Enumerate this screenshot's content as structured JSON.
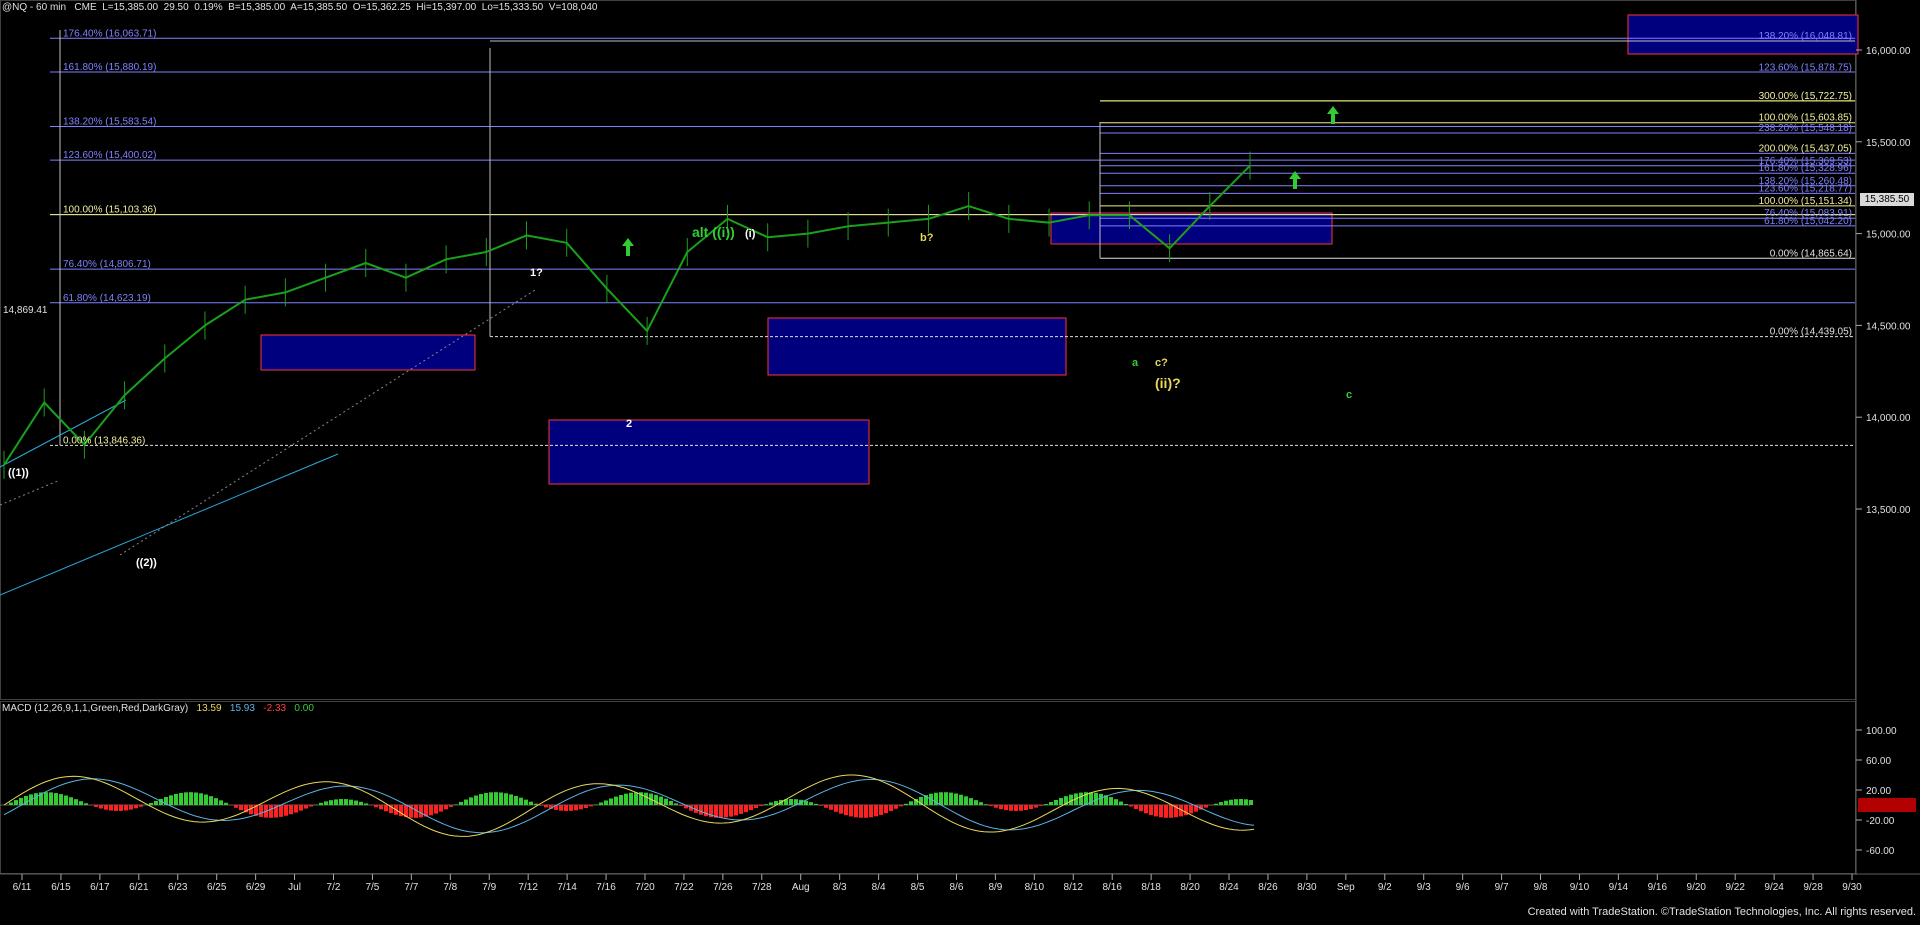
{
  "header": {
    "symbol": "@NQ - 60 min",
    "exchange": "CME",
    "last": "L=15,385.00",
    "change": "29.50",
    "change_pct": "0.19%",
    "bid": "B=15,385.00",
    "ask": "A=15,385.50",
    "open": "O=15,362.25",
    "high": "Hi=15,397.00",
    "low": "Lo=15,333.50",
    "volume": "V=108,040"
  },
  "price_axis": {
    "ticks": [
      {
        "value": 16000,
        "label": "16,000.00"
      },
      {
        "value": 15500,
        "label": "15,500.00"
      },
      {
        "value": 15000,
        "label": "15,000.00"
      },
      {
        "value": 14500,
        "label": "14,500.00"
      },
      {
        "value": 14000,
        "label": "14,000.00"
      },
      {
        "value": 13500,
        "label": "13,500.00"
      }
    ],
    "last_price_marker": "15,385.50",
    "left_marker": "14,869.41"
  },
  "macd": {
    "title": "MACD (12,26,9,1,1,Green,Red,DarkGray)",
    "values": [
      "13.59",
      "15.93",
      "-2.33",
      "0.00"
    ],
    "value_colors": [
      "#e8d85a",
      "#5ab4e8",
      "#ff4040",
      "#33cc33"
    ],
    "ticks": [
      "100.00",
      "60.00",
      "20.00",
      "-20.00",
      "-60.00"
    ]
  },
  "time_axis": [
    "6/11",
    "6/15",
    "6/17",
    "6/21",
    "6/23",
    "6/25",
    "6/29",
    "Jul",
    "7/2",
    "7/5",
    "7/7",
    "7/8",
    "7/9",
    "7/12",
    "7/14",
    "7/16",
    "7/20",
    "7/22",
    "7/26",
    "7/28",
    "Aug",
    "8/3",
    "8/4",
    "8/5",
    "8/6",
    "8/9",
    "8/10",
    "8/12",
    "8/16",
    "8/18",
    "8/20",
    "8/24",
    "8/26",
    "8/30",
    "Sep",
    "9/2",
    "9/3",
    "9/6",
    "9/7",
    "9/8",
    "9/10",
    "9/14",
    "9/16",
    "9/20",
    "9/22",
    "9/24",
    "9/28",
    "9/30"
  ],
  "fib_labels": [
    {
      "text": "176.40% (16,063.71)",
      "price": 16063.71,
      "side": "left"
    },
    {
      "text": "161.80% (15,880.19)",
      "price": 15880.19,
      "side": "left"
    },
    {
      "text": "138.20% (15,583.54)",
      "price": 15583.54,
      "side": "left"
    },
    {
      "text": "123.60% (15,400.02)",
      "price": 15400.02,
      "side": "left"
    },
    {
      "text": "100.00% (15,103.36)",
      "price": 15103.36,
      "side": "left"
    },
    {
      "text": "76.40% (14,806.71)",
      "price": 14806.71,
      "side": "left"
    },
    {
      "text": "61.80% (14,623.19)",
      "price": 14623.19,
      "side": "left"
    },
    {
      "text": "0.00% (13,846.36)",
      "price": 13846.36,
      "side": "left"
    },
    {
      "text": "138.20% (16,048.81)",
      "price": 16048.81,
      "side": "right"
    },
    {
      "text": "123.60% (15,878.75)",
      "price": 15878.75,
      "side": "right"
    },
    {
      "text": "300.00% (15,722.75)",
      "price": 15722.75,
      "side": "right"
    },
    {
      "text": "100.00% (15,603.85)",
      "price": 15603.85,
      "side": "right"
    },
    {
      "text": "238.20% (15,548.18)",
      "price": 15548.18,
      "side": "right"
    },
    {
      "text": "200.00% (15,437.05)",
      "price": 15437.05,
      "side": "right"
    },
    {
      "text": "176.40% (15,369.53)",
      "price": 15369.53,
      "side": "right"
    },
    {
      "text": "161.80% (15,328.96)",
      "price": 15328.96,
      "side": "right"
    },
    {
      "text": "138.20% (15,260.48)",
      "price": 15260.48,
      "side": "right"
    },
    {
      "text": "123.60% (15,218.77)",
      "price": 15218.77,
      "side": "right"
    },
    {
      "text": "100.00% (15,151.34)",
      "price": 15151.34,
      "side": "right"
    },
    {
      "text": "76.40% (15,083.91)",
      "price": 15083.91,
      "side": "right"
    },
    {
      "text": "61.80% (15,042.20)",
      "price": 15042.2,
      "side": "right"
    },
    {
      "text": "0.00% (14,865.64)",
      "price": 14865.64,
      "side": "right"
    },
    {
      "text": "0.00% (14,439.05)",
      "price": 14439.05,
      "side": "right"
    }
  ],
  "wave_labels": [
    {
      "text": "((1))",
      "color": "#ffffff"
    },
    {
      "text": "((2))",
      "color": "#ffffff"
    },
    {
      "text": "1?",
      "color": "#ffffff"
    },
    {
      "text": "2",
      "color": "#ffffff"
    },
    {
      "text": "alt ((i))",
      "color": "#33cc33"
    },
    {
      "text": "(i)",
      "color": "#ffffff"
    },
    {
      "text": "b?",
      "color": "#e8d85a"
    },
    {
      "text": "a",
      "color": "#33cc33"
    },
    {
      "text": "c?",
      "color": "#e8d85a"
    },
    {
      "text": "(ii)?",
      "color": "#e8d85a"
    },
    {
      "text": "c",
      "color": "#33cc33"
    }
  ],
  "footer": "Created with TradeStation. ©TradeStation Technologies, Inc. All rights reserved.",
  "colors": {
    "background": "#000000",
    "box_fill": "#00007f",
    "box_border": "#ff3333",
    "fib_blue": "#8080ff",
    "fib_yellow": "#f0f080",
    "wave_green": "#33cc33",
    "price_bar": "#1aa01a",
    "macd_line": "#e8d85a",
    "signal_line": "#5ab4e8",
    "hist_pos": "#33cc33",
    "hist_neg": "#ff2020"
  },
  "chart_data": {
    "type": "line",
    "title": "@NQ - 60 min",
    "xlabel": "",
    "ylabel": "",
    "ylim": [
      13200,
      16250
    ],
    "x": [
      "6/11",
      "6/15",
      "6/17",
      "6/21",
      "6/23",
      "6/25",
      "6/29",
      "Jul",
      "7/2",
      "7/5",
      "7/7",
      "7/8",
      "7/9",
      "7/12",
      "7/14",
      "7/16",
      "7/20",
      "7/22",
      "7/26",
      "7/28",
      "Aug",
      "8/3",
      "8/4",
      "8/5",
      "8/6",
      "8/9",
      "8/10",
      "8/12",
      "8/16",
      "8/18",
      "8/20",
      "8/24"
    ],
    "series": [
      {
        "values": [
          13740,
          14080,
          13850,
          14120,
          14320,
          14500,
          14640,
          14680,
          14760,
          14840,
          14760,
          14860,
          14900,
          14990,
          14950,
          14700,
          14470,
          14900,
          15080,
          14980,
          15000,
          15040,
          15060,
          15080,
          15150,
          15080,
          15060,
          15100,
          15100,
          14920,
          15150,
          15370
        ]
      }
    ],
    "macd": {
      "macd": 13.59,
      "signal": 15.93,
      "histogram": -2.33,
      "zero": 0.0,
      "ylim": [
        -85,
        115
      ]
    }
  }
}
